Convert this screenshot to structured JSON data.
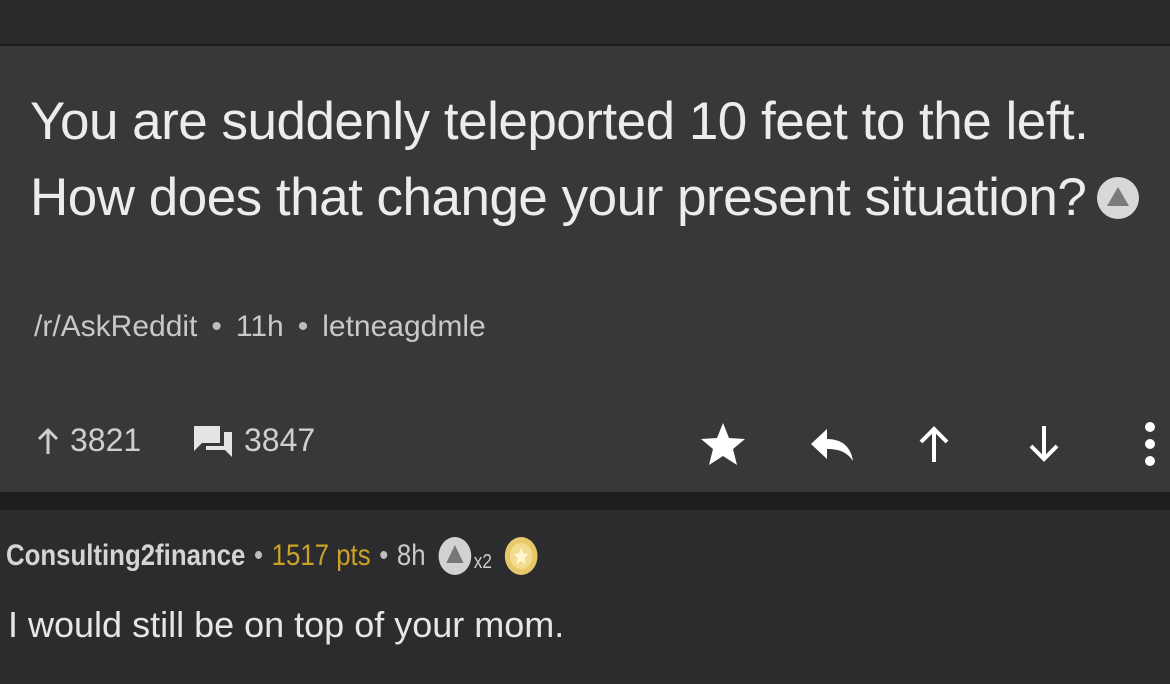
{
  "post": {
    "title": "You are suddenly teleported 10 feet to the left. How does that change your present situation?",
    "award_icon": "silver-award-icon",
    "subreddit": "/r/AskReddit",
    "age": "11h",
    "author": "letneagdmle",
    "upvotes": "3821",
    "comments": "3847",
    "actions": [
      "star-icon",
      "reply-icon",
      "upvote-arrow-icon",
      "downvote-arrow-icon",
      "more-icon"
    ]
  },
  "comment": {
    "author": "Consulting2finance",
    "points": "1517 pts",
    "age": "8h",
    "award_count": "x2",
    "awards": [
      "silver-award-icon",
      "gold-award-icon"
    ],
    "body": "I would still be on top of your mom."
  },
  "colors": {
    "background": "#2c2c2e",
    "post_background": "#38383a",
    "points": "#c9a227",
    "gold_award": "#e8c96a"
  }
}
